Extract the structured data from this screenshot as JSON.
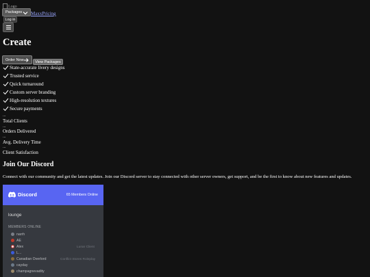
{
  "header": {
    "logo_alt": "Logo",
    "packages_label": "Packages",
    "maxx_label": "MaxxPricing",
    "login_label": "Log in"
  },
  "hero": {
    "title": "Create",
    "order_label": "Order Now",
    "view_label": "View Packages"
  },
  "features": [
    "State-accurate livery designs",
    "Trusted service",
    "Quick turnaround",
    "Custom server branding",
    "High-resolution textures",
    "Secure payments"
  ],
  "stats": [
    {
      "value": "...",
      "label": "Total Clients"
    },
    {
      "value": "...",
      "label": "Orders Delivered"
    },
    {
      "value": "...",
      "label": "Avg. Delivery Time"
    },
    {
      "value": "...",
      "label": "Client Satisfaction"
    }
  ],
  "discord": {
    "title": "Join Our Discord",
    "description": "Connect with our community and get the latest updates. Join our Discord server to stay connected with other server owners, get support, and be the first to know about new features and updates.",
    "widget": {
      "brand": "Discord",
      "members_online": "65 Members Online",
      "channel": "lounge",
      "members_title": "MEMBERS ONLINE",
      "members": [
        {
          "name": "narrh",
          "game": "",
          "color": "#7a7f88"
        },
        {
          "name": "AE",
          "game": "",
          "color": "#c0392b"
        },
        {
          "name": "Alex",
          "game": "Lunar Client",
          "color": "#e8e8e8"
        },
        {
          "name": "L...",
          "game": "",
          "color": "#3b5bdb"
        },
        {
          "name": "Canadian Overlord",
          "game": "Conflict Stores Roleplay",
          "color": "#8a6d3b"
        },
        {
          "name": "cayday",
          "game": "",
          "color": "#6c7a89"
        },
        {
          "name": "champagnevadity",
          "game": "",
          "color": "#9b8a6a"
        }
      ]
    }
  },
  "colors": {
    "background": "#121212",
    "discord_blurple": "#5865f2",
    "widget_bg": "#36393f",
    "link": "#9aa7ff"
  }
}
